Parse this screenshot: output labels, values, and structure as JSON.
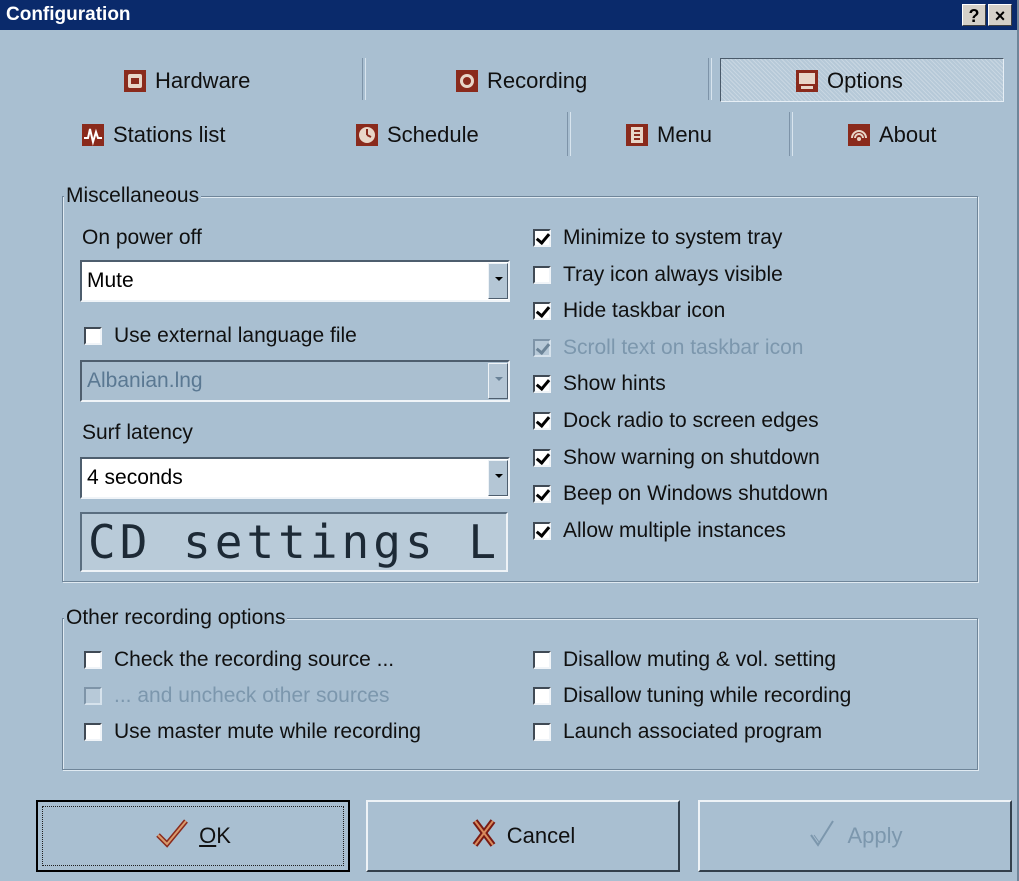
{
  "window": {
    "title": "Configuration",
    "help_label": "?",
    "close_label": "×"
  },
  "tabs_row1": [
    {
      "label": "Hardware",
      "icon": "hardware-icon"
    },
    {
      "label": "Recording",
      "icon": "recording-icon"
    },
    {
      "label": "Options",
      "icon": "options-icon",
      "active": true
    }
  ],
  "tabs_row2": [
    {
      "label": "Stations list",
      "icon": "stations-list-icon"
    },
    {
      "label": "Schedule",
      "icon": "clock-icon"
    },
    {
      "label": "Menu",
      "icon": "menu-icon"
    },
    {
      "label": "About",
      "icon": "about-icon"
    }
  ],
  "misc": {
    "group_label": "Miscellaneous",
    "power_off_label": "On power off",
    "power_off_value": "Mute",
    "use_language_label": "Use external language file",
    "use_language_checked": false,
    "language_value": "Albanian.lng",
    "surf_latency_label": "Surf latency",
    "surf_latency_value": "4 seconds",
    "lcd_text": "CD settings L",
    "checks": [
      {
        "label": "Minimize to system tray",
        "checked": true,
        "disabled": false
      },
      {
        "label": "Tray icon always visible",
        "checked": false,
        "disabled": false
      },
      {
        "label": "Hide taskbar icon",
        "checked": true,
        "disabled": false
      },
      {
        "label": "Scroll text on taskbar icon",
        "checked": true,
        "disabled": true
      },
      {
        "label": "Show hints",
        "checked": true,
        "disabled": false
      },
      {
        "label": "Dock radio to screen edges",
        "checked": true,
        "disabled": false
      },
      {
        "label": "Show warning on shutdown",
        "checked": true,
        "disabled": false
      },
      {
        "label": "Beep on Windows shutdown",
        "checked": true,
        "disabled": false
      },
      {
        "label": "Allow multiple instances",
        "checked": true,
        "disabled": false
      }
    ]
  },
  "rec": {
    "group_label": "Other recording options",
    "left": [
      {
        "label": "Check the recording source ...",
        "checked": false,
        "disabled": false
      },
      {
        "label": "... and uncheck other sources",
        "checked": false,
        "disabled": true
      },
      {
        "label": "Use master mute while recording",
        "checked": false,
        "disabled": false
      }
    ],
    "right": [
      {
        "label": "Disallow muting & vol. setting",
        "checked": false,
        "disabled": false
      },
      {
        "label": "Disallow tuning while recording",
        "checked": false,
        "disabled": false
      },
      {
        "label": "Launch associated program",
        "checked": false,
        "disabled": false
      }
    ]
  },
  "buttons": {
    "ok_hotkey": "O",
    "ok_rest": "K",
    "cancel_label": "Cancel",
    "apply_label": "Apply"
  }
}
